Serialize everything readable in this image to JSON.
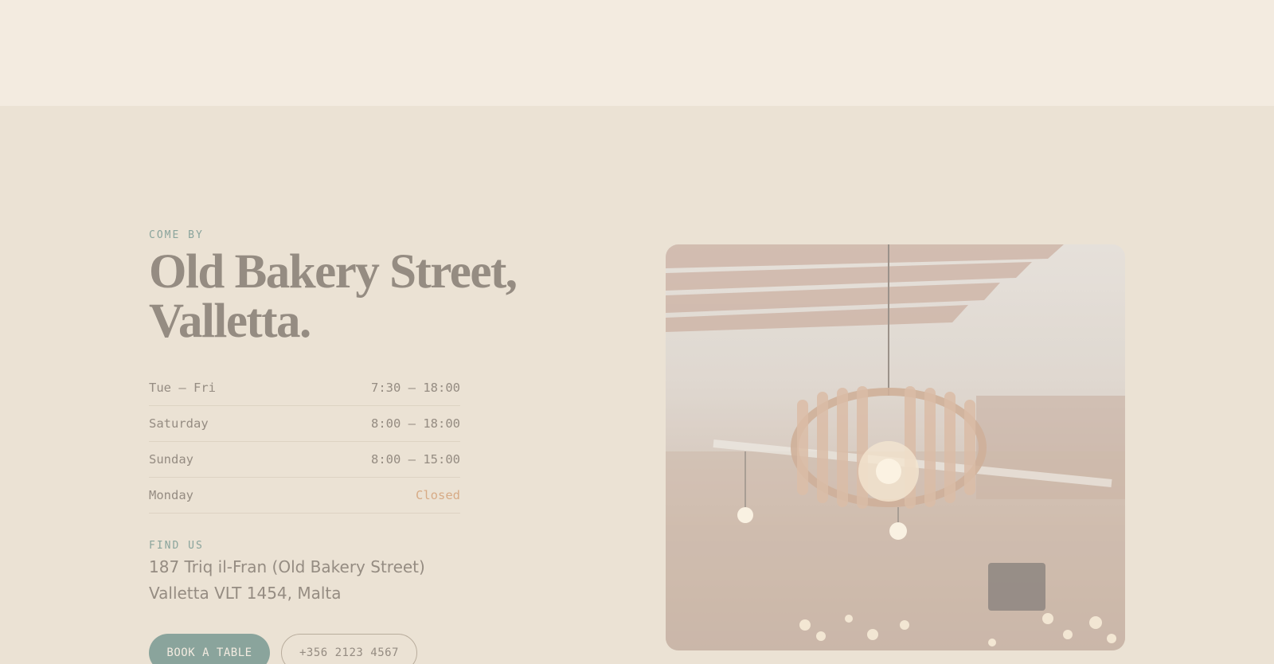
{
  "location": {
    "eyebrow": "COME BY",
    "title_line1": "Old Bakery Street,",
    "title_line2": "Valletta."
  },
  "hours": [
    {
      "days": "Tue – Fri",
      "time": "7:30 – 18:00"
    },
    {
      "days": "Saturday",
      "time": "8:00 – 18:00"
    },
    {
      "days": "Sunday",
      "time": "8:00 – 15:00"
    },
    {
      "days": "Monday",
      "time": "Closed"
    }
  ],
  "find_us": {
    "eyebrow": "FIND US",
    "address_line1": "187 Triq il-Fran (Old Bakery Street)",
    "address_line2": "Valletta VLT 1454, Malta"
  },
  "actions": {
    "book_label": "BOOK A TABLE",
    "phone_label": "+356 2123 4567"
  },
  "colors": {
    "background": "#ebe2d4",
    "top_band": "#f3ebe0",
    "accent_sage": "#8aa49c",
    "text_muted": "#958c82",
    "closed_accent": "#d7ab86"
  }
}
